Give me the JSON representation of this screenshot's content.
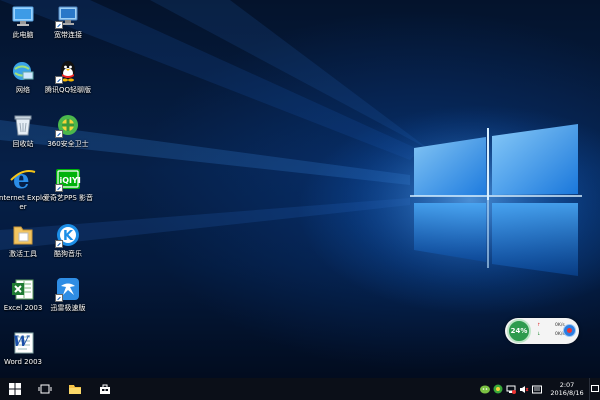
{
  "desktop": {
    "icons": [
      {
        "name": "this-pc-icon",
        "label": "此电脑"
      },
      {
        "name": "broadband-connection-icon",
        "label": "宽带连接"
      },
      {
        "name": "network-icon",
        "label": "网络"
      },
      {
        "name": "qq-icon",
        "label": "腾讯QQ轻聊版"
      },
      {
        "name": "recycle-bin-icon",
        "label": "回收站"
      },
      {
        "name": "360-security-icon",
        "label": "360安全卫士"
      },
      {
        "name": "internet-explorer-icon",
        "label": "Internet Explorer"
      },
      {
        "name": "iqiyi-pps-icon",
        "label": "爱奇艺PPS 影音"
      },
      {
        "name": "activation-tool-icon",
        "label": "激活工具"
      },
      {
        "name": "kugou-music-icon",
        "label": "酷狗音乐"
      },
      {
        "name": "excel-2003-icon",
        "label": "Excel 2003"
      },
      {
        "name": "xunlei-icon",
        "label": "迅雷极速版"
      },
      {
        "name": "word-2003-icon",
        "label": "Word 2003"
      }
    ]
  },
  "widget": {
    "percent": "24%",
    "up_speed": "0K/s",
    "down_speed": "0K/s",
    "colors": {
      "ring": "#2e9b4e",
      "up": "#d33",
      "down": "#2a8a3a"
    }
  },
  "taskbar": {
    "start": "windows-start-icon",
    "task_view": "task-view-icon",
    "explorer": "file-explorer-icon",
    "store": "store-icon"
  },
  "clock": {
    "time": "2:07",
    "date": "2016/8/16"
  }
}
